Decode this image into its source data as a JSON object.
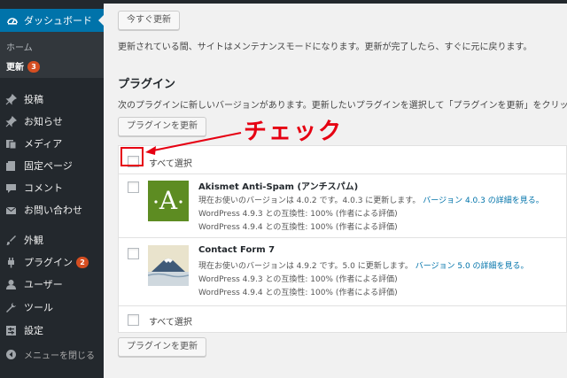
{
  "sidebar": {
    "dashboard_label": "ダッシュボード",
    "sub_home": "ホーム",
    "sub_updates": "更新",
    "updates_count": "3",
    "items": [
      {
        "label": "投稿",
        "icon": "pushpin-icon"
      },
      {
        "label": "お知らせ",
        "icon": "pushpin-icon"
      },
      {
        "label": "メディア",
        "icon": "media-icon"
      },
      {
        "label": "固定ページ",
        "icon": "page-icon"
      },
      {
        "label": "コメント",
        "icon": "comment-icon"
      },
      {
        "label": "お問い合わせ",
        "icon": "mail-icon"
      },
      {
        "label": "外観",
        "icon": "paintbrush-icon"
      },
      {
        "label": "プラグイン",
        "icon": "plugin-icon",
        "badge": "2"
      },
      {
        "label": "ユーザー",
        "icon": "user-icon"
      },
      {
        "label": "ツール",
        "icon": "wrench-icon"
      },
      {
        "label": "設定",
        "icon": "settings-icon"
      }
    ],
    "collapse_label": "メニューを閉じる"
  },
  "main": {
    "update_now_button": "今すぐ更新",
    "maintenance_note": "更新されている間、サイトはメンテナンスモードになります。更新が完了したら、すぐに元に戻ります。",
    "plugins_heading": "プラグイン",
    "plugins_intro": "次のプラグインに新しいバージョンがあります。更新したいプラグインを選択して「プラグインを更新」をクリック",
    "update_plugins_button": "プラグインを更新",
    "select_all_label": "すべて選択",
    "plugins": [
      {
        "name": "Akismet Anti-Spam (アンチスパム)",
        "line1": "現在お使いのバージョンは 4.0.2 です。4.0.3 に更新します。",
        "details_link": "バージョン 4.0.3 の詳細を見る。",
        "line2": "WordPress 4.9.3 との互換性: 100% (作者による評価)",
        "line3": "WordPress 4.9.4 との互換性: 100% (作者による評価)",
        "thumb_letter": "A"
      },
      {
        "name": "Contact Form 7",
        "line1": "現在お使いのバージョンは 4.9.2 です。5.0 に更新します。",
        "details_link": "バージョン 5.0 の詳細を見る。",
        "line2": "WordPress 4.9.3 との互換性: 100% (作者による評価)",
        "line3": "WordPress 4.9.4 との互換性: 100% (作者による評価)"
      }
    ]
  },
  "annotation": {
    "label": "チェック",
    "color": "#e60012"
  },
  "colors": {
    "sidebar_bg": "#23282d",
    "accent": "#0073aa",
    "badge": "#d54e21",
    "akismet_green": "#5d8c22"
  }
}
